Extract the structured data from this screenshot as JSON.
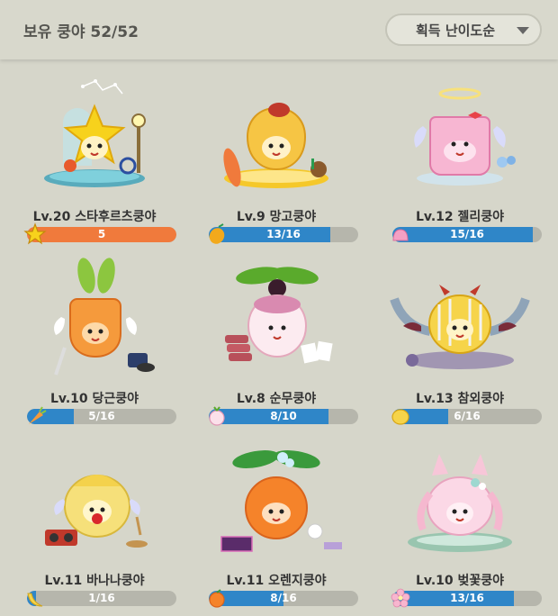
{
  "header": {
    "owned_label": "보유 쿵야 52/52",
    "sort": {
      "label": "획득 난이도순",
      "icon": "triangle-down-icon"
    }
  },
  "cards": [
    {
      "name": "Lv.20 스타후르츠쿵야",
      "progress_text": "5",
      "progress": 1.0,
      "bar_color": "#f07a3c",
      "icon": "star-fruit-icon"
    },
    {
      "name": "Lv.9 망고쿵야",
      "progress_text": "13/16",
      "progress": 0.8125,
      "bar_color": "#2f86c8",
      "icon": "mango-icon"
    },
    {
      "name": "Lv.12 젤리쿵야",
      "progress_text": "15/16",
      "progress": 0.9375,
      "bar_color": "#2f86c8",
      "icon": "jelly-icon"
    },
    {
      "name": "Lv.10 당근쿵야",
      "progress_text": "5/16",
      "progress": 0.3125,
      "bar_color": "#2f86c8",
      "icon": "carrot-icon"
    },
    {
      "name": "Lv.8 순무쿵야",
      "progress_text": "8/10",
      "progress": 0.8,
      "bar_color": "#2f86c8",
      "icon": "turnip-icon"
    },
    {
      "name": "Lv.13 참외쿵야",
      "progress_text": "6/16",
      "progress": 0.375,
      "bar_color": "#2f86c8",
      "icon": "korean-melon-icon"
    },
    {
      "name": "Lv.11 바나나쿵야",
      "progress_text": "1/16",
      "progress": 0.0625,
      "bar_color": "#2f86c8",
      "icon": "banana-icon"
    },
    {
      "name": "Lv.11 오렌지쿵야",
      "progress_text": "8/16",
      "progress": 0.5,
      "bar_color": "#2f86c8",
      "icon": "orange-icon"
    },
    {
      "name": "Lv.10 벚꽃쿵야",
      "progress_text": "13/16",
      "progress": 0.8125,
      "bar_color": "#2f86c8",
      "icon": "cherry-blossom-icon"
    }
  ]
}
